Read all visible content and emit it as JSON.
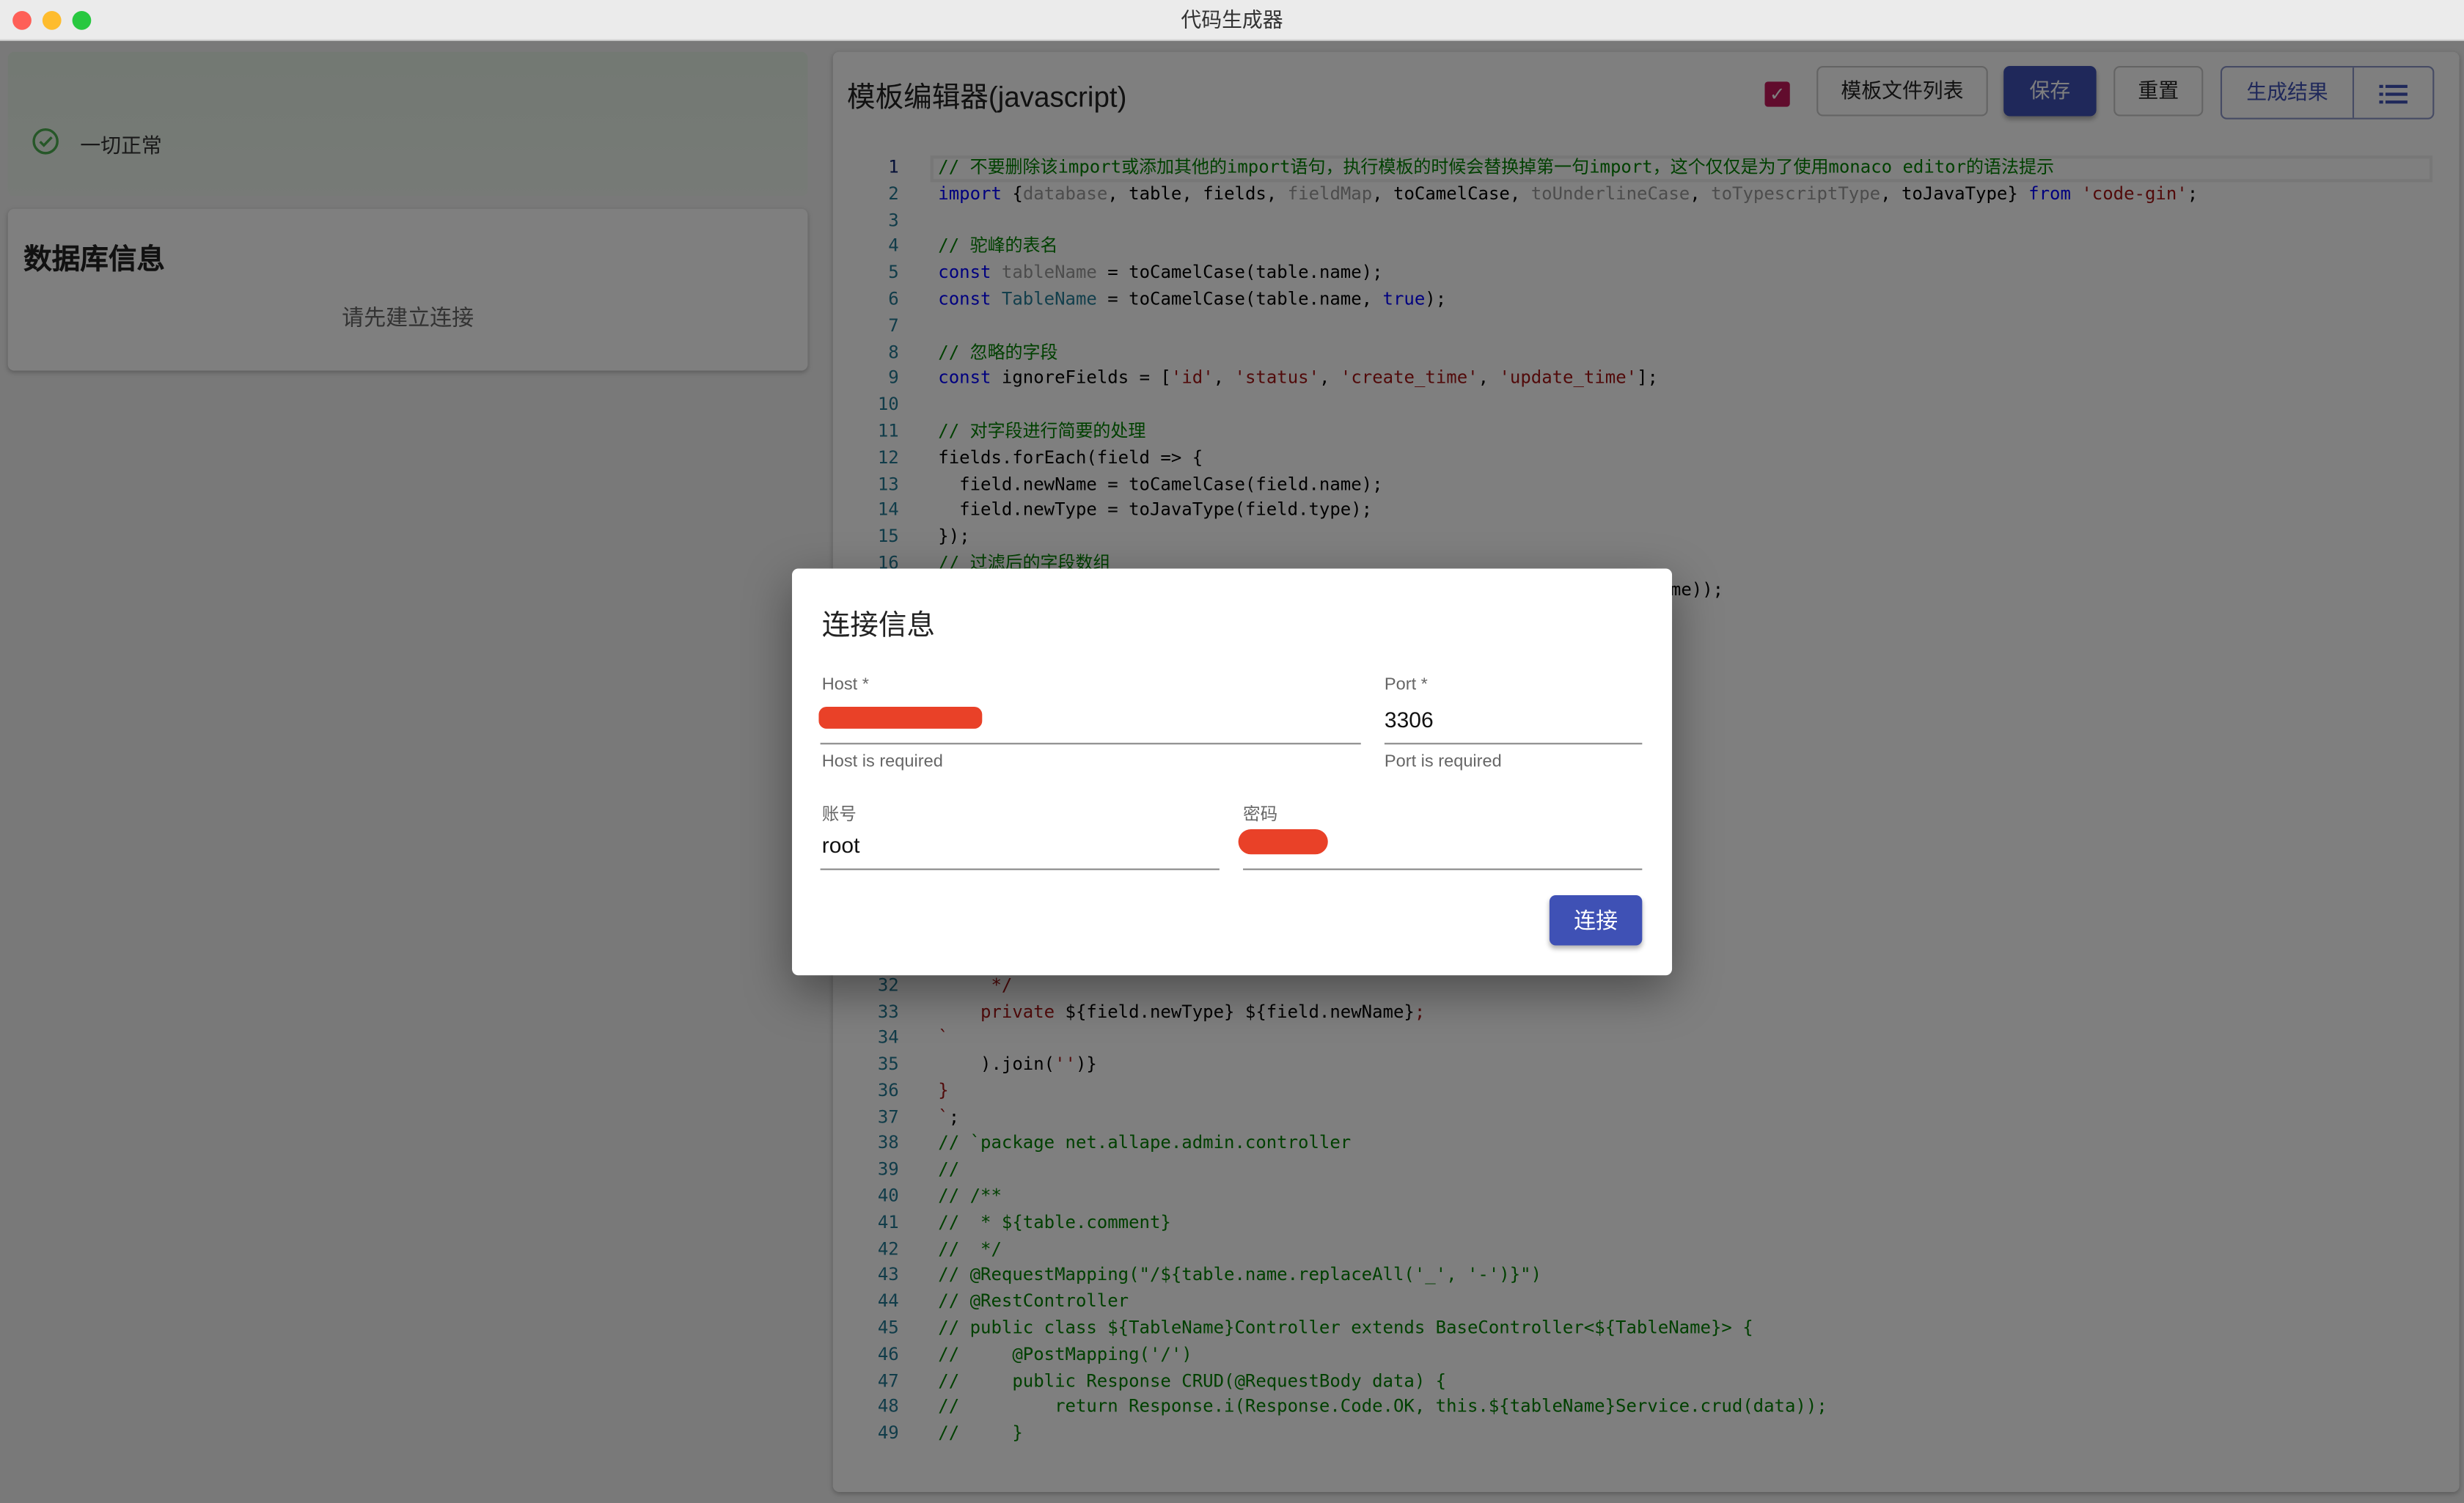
{
  "window": {
    "title": "代码生成器"
  },
  "status": {
    "icon": "check-circle-icon",
    "text": "一切正常"
  },
  "db_info": {
    "title": "数据库信息",
    "empty_text": "请先建立连接"
  },
  "editor": {
    "title": "模板编辑器(javascript)",
    "checkbox_checked": true,
    "buttons": {
      "file_list": "模板文件列表",
      "save": "保存",
      "reset": "重置",
      "generate": "生成结果",
      "menu_icon": "list-icon"
    },
    "lines": [
      [
        [
          "// 不要删除该import或添加其他的import语句，执行模板的时候会替换掉第一句import，这个仅仅是为了使用monaco editor的语法提示",
          "c"
        ]
      ],
      [
        [
          "import ",
          "k"
        ],
        [
          "{",
          "p"
        ],
        [
          "database",
          "u"
        ],
        [
          ", table, fields, ",
          "p"
        ],
        [
          "fieldMap",
          "u"
        ],
        [
          ", toCamelCase, ",
          "p"
        ],
        [
          "toUnderlineCase",
          "u"
        ],
        [
          ", ",
          "p"
        ],
        [
          "toTypescriptType",
          "u"
        ],
        [
          ", toJavaType} ",
          "p"
        ],
        [
          "from ",
          "k"
        ],
        [
          "'code-gin'",
          "s"
        ],
        [
          ";",
          "p"
        ]
      ],
      [],
      [
        [
          "// 驼峰的表名",
          "c"
        ]
      ],
      [
        [
          "const ",
          "k"
        ],
        [
          "tableName",
          "u"
        ],
        [
          " = toCamelCase(table.name);",
          "p"
        ]
      ],
      [
        [
          "const ",
          "k"
        ],
        [
          "TableName",
          "tn"
        ],
        [
          " = toCamelCase(table.name, ",
          "p"
        ],
        [
          "true",
          "k"
        ],
        [
          ");",
          "p"
        ]
      ],
      [],
      [
        [
          "// 忽略的字段",
          "c"
        ]
      ],
      [
        [
          "const ",
          "k"
        ],
        [
          "ignoreFields = [",
          "p"
        ],
        [
          "'id'",
          "s"
        ],
        [
          ", ",
          "p"
        ],
        [
          "'status'",
          "s"
        ],
        [
          ", ",
          "p"
        ],
        [
          "'create_time'",
          "s"
        ],
        [
          ", ",
          "p"
        ],
        [
          "'update_time'",
          "s"
        ],
        [
          "];",
          "p"
        ]
      ],
      [],
      [
        [
          "// 对字段进行简要的处理",
          "c"
        ]
      ],
      [
        [
          "fields.forEach(field => {",
          "p"
        ]
      ],
      [
        [
          "  field.newName = toCamelCase(field.name);",
          "p"
        ]
      ],
      [
        [
          "  field.newType = toJavaType(field.type);",
          "p"
        ]
      ],
      [
        [
          "});",
          "p"
        ]
      ],
      [
        [
          "// 过滤后的字段数组",
          "c"
        ]
      ],
      [
        [
          "me));",
          "p"
        ]
      ],
      [],
      [],
      [],
      [],
      [],
      [],
      [],
      [],
      [],
      [],
      [],
      [],
      [],
      [],
      [
        [
          "     */",
          "s"
        ]
      ],
      [
        [
          "    private ",
          "s"
        ],
        [
          "${field.newType} ${field.newName}",
          "p"
        ],
        [
          ";",
          "s"
        ]
      ],
      [
        [
          "`",
          "s"
        ]
      ],
      [
        [
          "    ).join(",
          "p"
        ],
        [
          "''",
          "s"
        ],
        [
          ")}",
          "p"
        ]
      ],
      [
        [
          "}",
          "s"
        ]
      ],
      [
        [
          "`",
          "s"
        ],
        [
          ";",
          "p"
        ]
      ],
      [
        [
          "// `package net.allape.admin.controller",
          "c"
        ]
      ],
      [
        [
          "//",
          "c"
        ]
      ],
      [
        [
          "// /**",
          "c"
        ]
      ],
      [
        [
          "//  * ${table.comment}",
          "c"
        ]
      ],
      [
        [
          "//  */",
          "c"
        ]
      ],
      [
        [
          "// @RequestMapping(\"/${table.name.replaceAll('_', '-')}\")",
          "c"
        ]
      ],
      [
        [
          "// @RestController",
          "c"
        ]
      ],
      [
        [
          "// public class ${TableName}Controller extends BaseController<${TableName}> {",
          "c"
        ]
      ],
      [
        [
          "//     @PostMapping('/')",
          "c"
        ]
      ],
      [
        [
          "//     public Response CRUD(@RequestBody data) {",
          "c"
        ]
      ],
      [
        [
          "//         return Response.i(Response.Code.OK, this.${tableName}Service.crud(data));",
          "c"
        ]
      ],
      [
        [
          "//     }",
          "c"
        ]
      ]
    ]
  },
  "dialog": {
    "title": "连接信息",
    "host": {
      "label": "Host *",
      "value": "[redacted]",
      "helper": "Host is required"
    },
    "port": {
      "label": "Port *",
      "value": "3306",
      "helper": "Port is required"
    },
    "account": {
      "label": "账号",
      "value": "root"
    },
    "password": {
      "label": "密码",
      "value": "[redacted]"
    },
    "connect": "连接"
  },
  "colors": {
    "primary": "#3f51b5",
    "checkbox": "#c2185b",
    "redaction": "#e94128",
    "success": "#4caf50"
  }
}
